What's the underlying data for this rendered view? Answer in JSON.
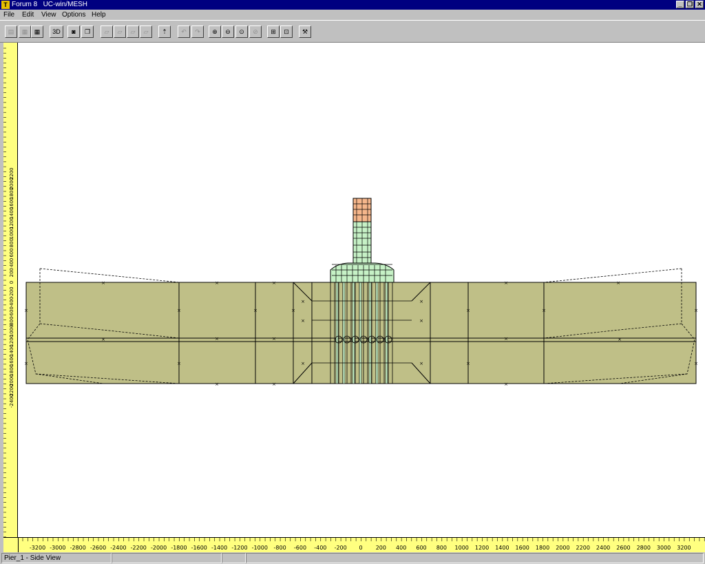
{
  "window": {
    "app_icon": "T",
    "title": "Forum 8   UC-win/MESH",
    "controls": [
      "_",
      "❐",
      "✕"
    ]
  },
  "menu": {
    "items": [
      {
        "label": "File"
      },
      {
        "label": "Edit"
      },
      {
        "label": "View"
      },
      {
        "label": "Options"
      },
      {
        "label": "Help"
      }
    ]
  },
  "toolbar": {
    "buttons": [
      {
        "name": "save-icon",
        "glyph": "▤",
        "enabled": false
      },
      {
        "name": "mesh-icon",
        "glyph": "▦",
        "enabled": false
      },
      {
        "name": "grid-icon",
        "glyph": "▦",
        "enabled": true
      },
      {
        "name": "3d-button",
        "glyph": "3D",
        "enabled": true
      },
      {
        "name": "camera-icon",
        "glyph": "◙",
        "enabled": true
      },
      {
        "name": "copy-icon",
        "glyph": "❐",
        "enabled": true
      },
      {
        "name": "edit1-icon",
        "glyph": "▱",
        "enabled": false
      },
      {
        "name": "edit2-icon",
        "glyph": "▱",
        "enabled": false
      },
      {
        "name": "edit3-icon",
        "glyph": "▱",
        "enabled": false
      },
      {
        "name": "edit4-icon",
        "glyph": "▱",
        "enabled": false
      },
      {
        "name": "upload-icon",
        "glyph": "⇡",
        "enabled": true
      },
      {
        "name": "undo-icon",
        "glyph": "↶",
        "enabled": false
      },
      {
        "name": "redo-icon",
        "glyph": "↷",
        "enabled": false
      },
      {
        "name": "zoom-in-icon",
        "glyph": "⊕",
        "enabled": true
      },
      {
        "name": "zoom-out-icon",
        "glyph": "⊖",
        "enabled": true
      },
      {
        "name": "zoom-fit-icon",
        "glyph": "⊙",
        "enabled": true
      },
      {
        "name": "zoom-window-icon",
        "glyph": "⊘",
        "enabled": false
      },
      {
        "name": "select-all-icon",
        "glyph": "⊞",
        "enabled": true
      },
      {
        "name": "frame-icon",
        "glyph": "⊡",
        "enabled": true
      },
      {
        "name": "tool-icon",
        "glyph": "⚒",
        "enabled": true
      }
    ]
  },
  "rulers": {
    "horizontal_labels": [
      "-3200",
      "-3000",
      "-2800",
      "-2600",
      "-2400",
      "-2200",
      "-2000",
      "-1800",
      "-1600",
      "-1400",
      "-1200",
      "-1000",
      "-800",
      "-600",
      "-400",
      "-200",
      "0",
      "200",
      "400",
      "600",
      "800",
      "1000",
      "1200",
      "1400",
      "1600",
      "1800",
      "2000",
      "2200",
      "2400",
      "2600",
      "2800",
      "3000",
      "3200"
    ],
    "vertical_labels": [
      "2200",
      "2000",
      "1800",
      "1600",
      "1400",
      "1200",
      "1000",
      "800",
      "600",
      "400",
      "200",
      "0",
      "-200",
      "-400",
      "-600",
      "-800",
      "-1000",
      "-1200",
      "-1400",
      "-1600",
      "-1800",
      "-2000",
      "-2200",
      "-2400"
    ]
  },
  "colors": {
    "footing": "#bfbf87",
    "column": "#c6f1c6",
    "column_top": "#f5b68b",
    "ruler": "#ffff80"
  },
  "status": {
    "view_label": "Pier_1 - Side View"
  }
}
